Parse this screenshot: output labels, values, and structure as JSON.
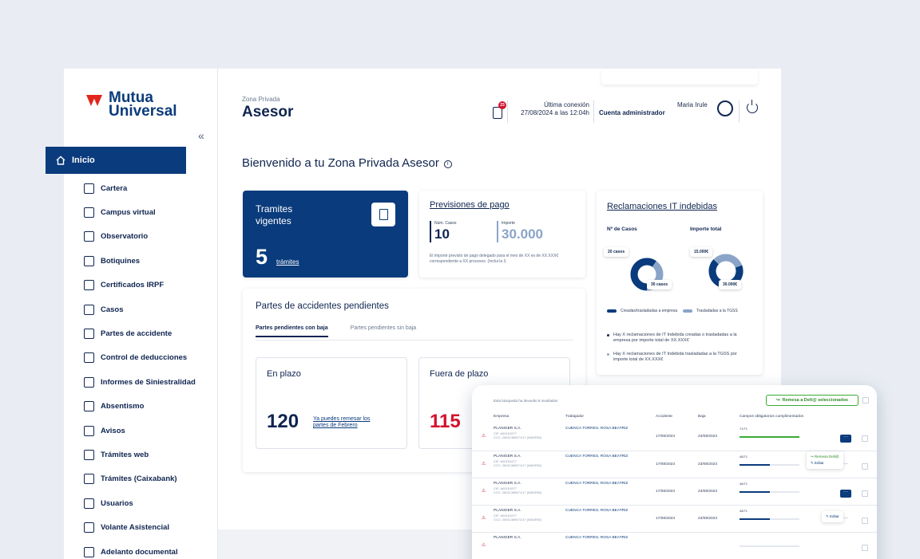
{
  "brand": {
    "line1": "Mutua",
    "line2": "Universal",
    "color": "#0a3b7c",
    "accent": "#e1261c"
  },
  "sidebar": {
    "collapse": "«",
    "active": "Inicio",
    "items": [
      {
        "label": "Cartera",
        "icon": "briefcase-icon"
      },
      {
        "label": "Campus virtual",
        "icon": "graduation-cap-icon"
      },
      {
        "label": "Observatorio",
        "icon": "magnifier-icon"
      },
      {
        "label": "Botiquines",
        "icon": "first-aid-kit-icon"
      },
      {
        "label": "Certificados IRPF",
        "icon": "certificate-icon"
      },
      {
        "label": "Casos",
        "icon": "person-icon"
      },
      {
        "label": "Partes de accidente",
        "icon": "injured-person-icon"
      },
      {
        "label": "Control de deducciones",
        "icon": "calculator-icon"
      },
      {
        "label": "Informes de Siniestralidad",
        "icon": "bar-chart-icon"
      },
      {
        "label": "Absentismo",
        "icon": "trend-chart-icon"
      },
      {
        "label": "Avisos",
        "icon": "bell-icon"
      },
      {
        "label": "Trámites web",
        "icon": "document-icon"
      },
      {
        "label": "Trámites (Caixabank)",
        "icon": "laptop-icon"
      },
      {
        "label": "Usuarios",
        "icon": "users-icon"
      },
      {
        "label": "Volante Asistencial",
        "icon": "medical-form-icon"
      },
      {
        "label": "Adelanto documental",
        "icon": "document-icon"
      }
    ]
  },
  "header": {
    "zone_label": "Zona Privada",
    "zone_title": "Asesor",
    "notifications": "23",
    "last_conn_label": "Última conexión",
    "last_conn_value": "27/08/2024 a las 12:04h",
    "account": "Cuenta administrador",
    "user": "Maria Irule"
  },
  "welcome": "Bienvenido a tu Zona Privada Asesor",
  "tramites": {
    "title_1": "Tramites",
    "title_2": "vigentes",
    "count": "5",
    "link": "trámites"
  },
  "previsiones": {
    "title": "Previsiones de pago",
    "cases_label": "Núm. Casos",
    "cases_value": "10",
    "amount_label": "Importe",
    "amount_value": "30.000",
    "note": "El importe previsto de pago delegado para el mes de XX es de XX.XXX€ correspondiente a XX procesos. (Inclui la I)"
  },
  "reclamaciones": {
    "title": "Reclamaciones IT indebidas",
    "cases_header": "Nº de Casos",
    "amount_header": "Importe total",
    "cases_a": "20 casos",
    "cases_b": "30 casos",
    "amount_a": "15.000€",
    "amount_b": "30.000€",
    "legend_a": "Creadas/trasladadas a empresa",
    "legend_b": "Trasladadas a la TGSS",
    "bullet_a": "Hay X reclamaciones de IT Indebida creadas o trasladadas a la empresa por importe total de XX.XXX€",
    "bullet_b": "Hay X reclamaciones de IT Indebida trasladadas a la TGSS por importe total de XX.XXX€",
    "color_a": "#0a3b7c",
    "color_b": "#8aa4c8"
  },
  "partes": {
    "title": "Partes de accidentes pendientes",
    "tab_active": "Partes pendientes con baja",
    "tab_inactive": "Partes pendientes sin baja",
    "en_plazo_title": "En plazo",
    "en_plazo_value": "120",
    "en_plazo_link": "Ya puedes remesar los partes de Febrero",
    "fuera_title": "Fuera de plazo",
    "fuera_value": "115"
  },
  "tablet": {
    "info": "Esta búsqueda ha devuelto 6 resultados",
    "remesa_button": "Remesa a Delt@ seleccionados",
    "columns": [
      "Empresa",
      "Trabajador",
      "Accidente",
      "Baja",
      "Campos obligatorios cumplimentados"
    ],
    "rows": [
      {
        "empresa": "PLANIGER S.A.",
        "cif": "CIF: A00151977",
        "ccc": "CCC: 28011369671/17 (MADRID)",
        "trabajador": "CUENCA TORRES, ROSA BEATRIZ",
        "accidente": "17/08/2023",
        "baja": "23/08/2023",
        "campos": "71/71",
        "fill": 1.0
      },
      {
        "empresa": "PLANIGER S.A.",
        "cif": "CIF: A00151977",
        "ccc": "CCC: 28011369671/17 (MADRID)",
        "trabajador": "CUENCA TORRES, ROSA BEATRIZ",
        "accidente": "17/08/2023",
        "baja": "23/08/2023",
        "campos": "48/71",
        "fill": 0.5
      },
      {
        "empresa": "PLANIGER S.A.",
        "cif": "CIF: A00151977",
        "ccc": "CCC: 28011369671/17 (MADRID)",
        "trabajador": "CUENCA TORRES, ROSA BEATRIZ",
        "accidente": "17/08/2023",
        "baja": "23/08/2023",
        "campos": "46/71",
        "fill": 0.5
      },
      {
        "empresa": "PLANIGER S.A.",
        "cif": "CIF: A00151977",
        "ccc": "CCC: 28011369671/17 (MADRID)",
        "trabajador": "CUENCA TORRES, ROSA BEATRIZ",
        "accidente": "17/08/2023",
        "baja": "23/08/2023",
        "campos": "48/71",
        "fill": 0.5
      },
      {
        "empresa": "PLANIGER S.A.",
        "cif": "",
        "ccc": "",
        "trabajador": "CUENCA TORRES, ROSA BEATRIZ",
        "accidente": "",
        "baja": "",
        "campos": "",
        "fill": 0
      }
    ],
    "menu_remesa": "Remesa Delt@",
    "menu_editar": "Editar",
    "success_color": "#3aaa35"
  }
}
